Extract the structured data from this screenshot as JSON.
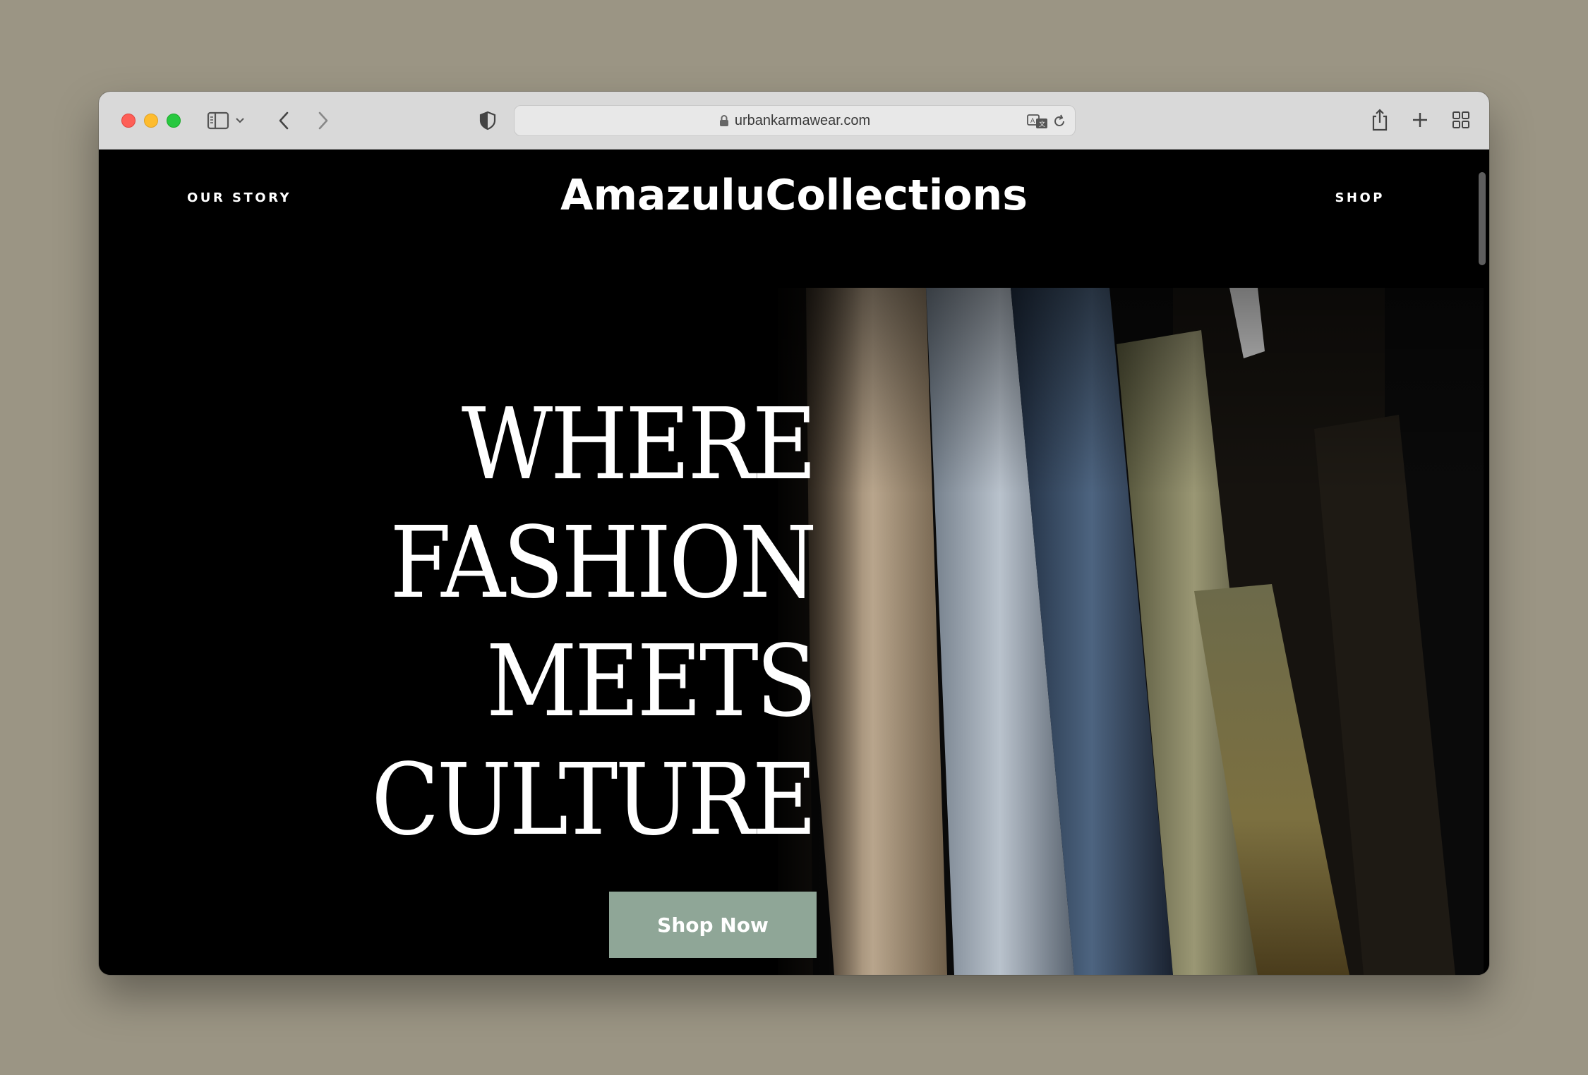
{
  "browser": {
    "url": "urbankarmawear.com",
    "icons": [
      "sidebar-icon",
      "chevron-down-icon",
      "back-icon",
      "forward-icon",
      "shield-icon",
      "lock-icon",
      "translate-icon",
      "reload-icon",
      "share-icon",
      "plus-icon",
      "tabs-grid-icon"
    ]
  },
  "site": {
    "nav_left": "OUR STORY",
    "logo": "AmazuluCollections",
    "nav_right": "SHOP"
  },
  "hero": {
    "headline_lines": [
      "WHERE",
      "FASHION",
      "MEETS",
      "CULTURE"
    ],
    "cta_label": "Shop Now"
  },
  "colors": {
    "page_bg": "#000000",
    "cta_bg": "#8fa697",
    "desktop_bg": "#9b9584"
  }
}
